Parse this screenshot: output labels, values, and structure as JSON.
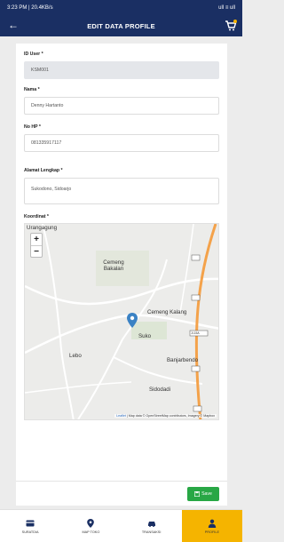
{
  "status_bar": {
    "left": "3:23 PM | 20.4KB/s",
    "right": "ull ≡ ull"
  },
  "header": {
    "title": "EDIT DATA PROFILE"
  },
  "form": {
    "id_user_label": "ID User *",
    "id_user_value": "KSM001",
    "nama_label": "Nama *",
    "nama_value": "Denny Hartanto",
    "nohp_label": "No HP *",
    "nohp_value": "081335917117",
    "alamat_label": "Alamat Lengkap *",
    "alamat_value": "Sukodono, Sidoarjo",
    "koordinat_label": "Koordinat *",
    "save_label": "Save"
  },
  "map": {
    "places": [
      "Urangagung",
      "Cemeng Bakalan",
      "Cemeng Kalang",
      "Suko",
      "Lebo",
      "Banjarbendo",
      "Sidodadi"
    ],
    "road_badge": "Jl-15A",
    "attribution_link": "Leaflet",
    "attribution_text": "| Map data © OpenStreetMap contributors, Imagery © Mapbox"
  },
  "nav": {
    "items": [
      {
        "label": "Suratdia",
        "icon": "card-icon"
      },
      {
        "label": "Map Toko",
        "icon": "map-pin-icon"
      },
      {
        "label": "Transaksi",
        "icon": "car-icon"
      },
      {
        "label": "Profile",
        "icon": "person-icon"
      }
    ]
  },
  "colors": {
    "header": "#1a2f63",
    "accent": "#f5b400",
    "save": "#28a745",
    "marker": "#3a82c4",
    "road_orange": "#f4a24a"
  }
}
